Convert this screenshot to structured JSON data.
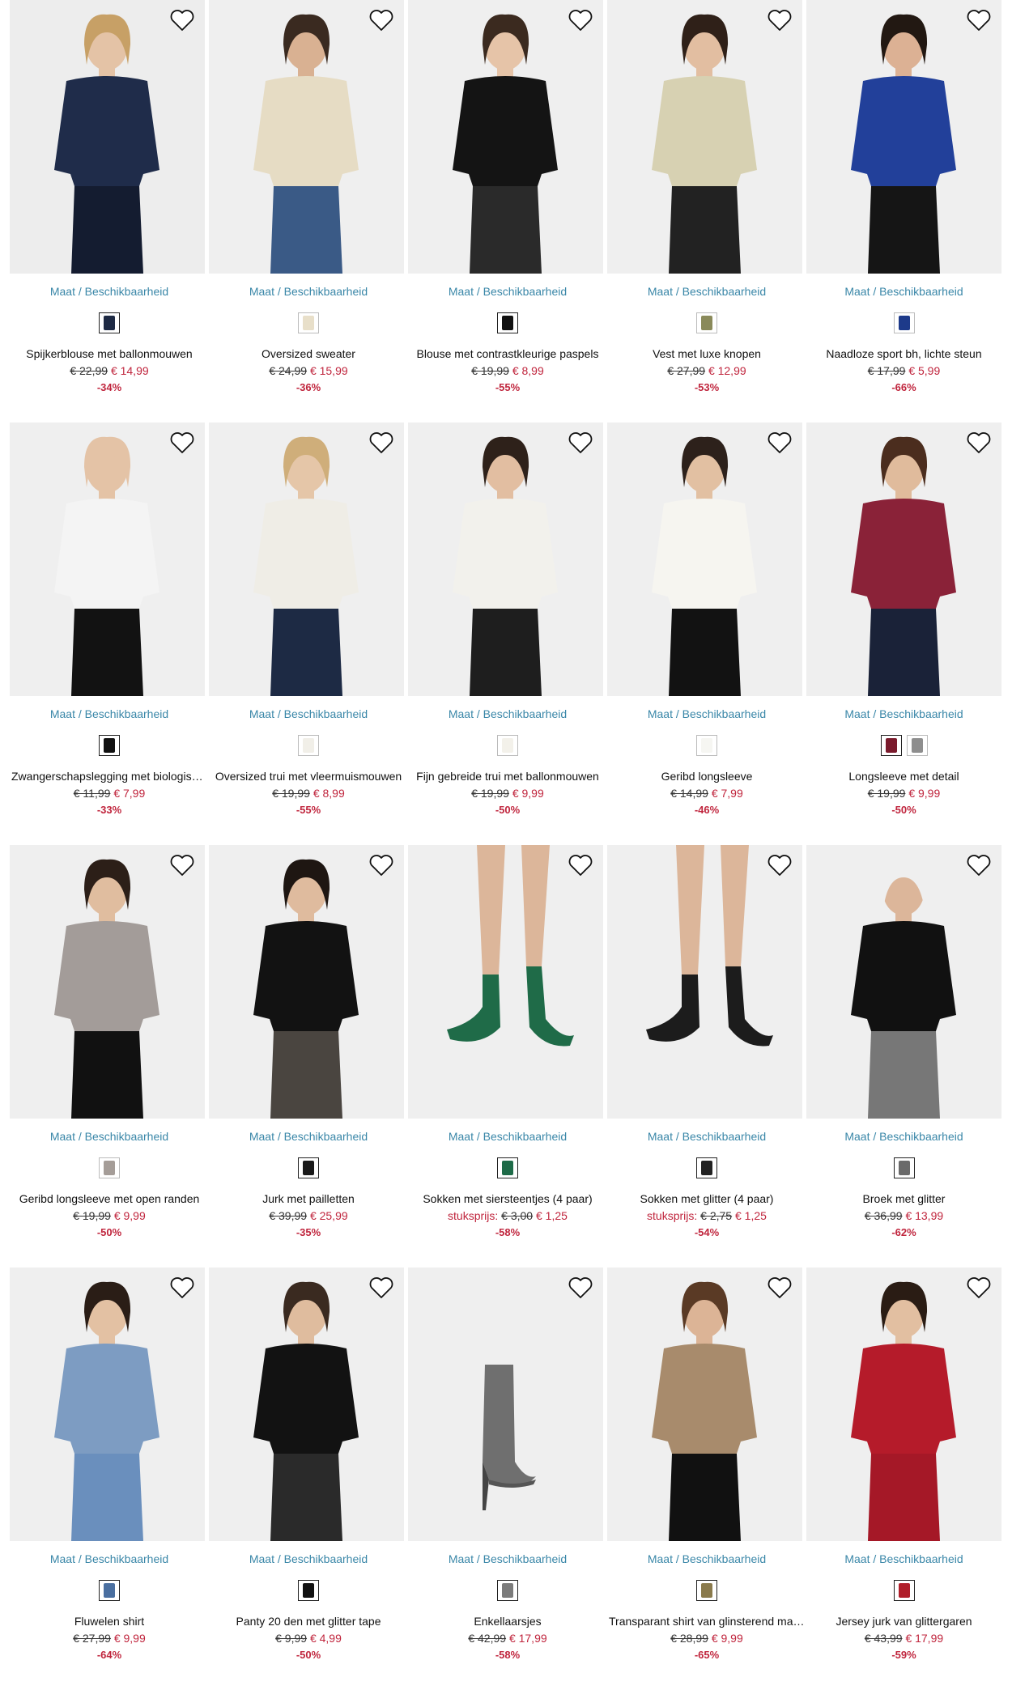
{
  "ui": {
    "size_label": "Maat / Beschikbaarheid",
    "colors": {
      "link": "#3a87a8",
      "sale": "#c0253d"
    }
  },
  "rows": [
    [
      {
        "name": "Spijkerblouse met ballonmouwen",
        "old": "€ 22,99",
        "new": "€ 14,99",
        "discount": "-34%",
        "prefix": "",
        "swatches": [
          {
            "color": "#1e2a44",
            "selected": true
          }
        ],
        "photo": {
          "bg": "#ededed",
          "top": "#1f2c4a",
          "bottom": "#141c30",
          "skin": "#e4c3a6",
          "hair": "#c7a066"
        }
      },
      {
        "name": "Oversized sweater",
        "old": "€ 24,99",
        "new": "€ 15,99",
        "discount": "-36%",
        "prefix": "",
        "swatches": [
          {
            "color": "#e8dfc9",
            "selected": false
          }
        ],
        "photo": {
          "bg": "#efefef",
          "top": "#e6dcc4",
          "bottom": "#3a5a86",
          "skin": "#d9b192",
          "hair": "#3a2a20"
        }
      },
      {
        "name": "Blouse met contrastkleurige paspels",
        "old": "€ 19,99",
        "new": "€ 8,99",
        "discount": "-55%",
        "prefix": "",
        "swatches": [
          {
            "color": "#111111",
            "selected": true
          }
        ],
        "photo": {
          "bg": "#efefef",
          "top": "#141414",
          "bottom": "#2a2a2a",
          "skin": "#e6c4a8",
          "hair": "#3b2a1f"
        }
      },
      {
        "name": "Vest met luxe knopen",
        "old": "€ 27,99",
        "new": "€ 12,99",
        "discount": "-53%",
        "prefix": "",
        "swatches": [
          {
            "color": "#8a8a5a",
            "selected": false
          }
        ],
        "photo": {
          "bg": "#efefef",
          "top": "#d7d1b2",
          "bottom": "#222222",
          "skin": "#e2bea1",
          "hair": "#2f2018"
        }
      },
      {
        "name": "Naadloze sport bh, lichte steun",
        "old": "€ 17,99",
        "new": "€ 5,99",
        "discount": "-66%",
        "prefix": "",
        "swatches": [
          {
            "color": "#1d3a8a",
            "selected": false
          }
        ],
        "photo": {
          "bg": "#efefef",
          "top": "#22409a",
          "bottom": "#151515",
          "skin": "#dcb194",
          "hair": "#221812"
        }
      }
    ],
    [
      {
        "name": "Zwangerschapslegging met biologisch katoen",
        "old": "€ 11,99",
        "new": "€ 7,99",
        "discount": "-33%",
        "prefix": "",
        "swatches": [
          {
            "color": "#111111",
            "selected": true
          }
        ],
        "photo": {
          "bg": "#efefef",
          "top": "#f4f4f4",
          "bottom": "#121212",
          "skin": "#e4c3a6",
          "hair": "#e4c3a6"
        }
      },
      {
        "name": "Oversized trui met vleermuismouwen",
        "old": "€ 19,99",
        "new": "€ 8,99",
        "discount": "-55%",
        "prefix": "",
        "swatches": [
          {
            "color": "#f1efe8",
            "selected": false
          }
        ],
        "photo": {
          "bg": "#efefef",
          "top": "#efede6",
          "bottom": "#1d2a44",
          "skin": "#e5c6a8",
          "hair": "#cfae7a"
        }
      },
      {
        "name": "Fijn gebreide trui met ballonmouwen",
        "old": "€ 19,99",
        "new": "€ 9,99",
        "discount": "-50%",
        "prefix": "",
        "swatches": [
          {
            "color": "#f3f1ea",
            "selected": false
          }
        ],
        "photo": {
          "bg": "#efefef",
          "top": "#f2f1ec",
          "bottom": "#1e1e1e",
          "skin": "#e2bea1",
          "hair": "#2e211a"
        }
      },
      {
        "name": "Geribd longsleeve",
        "old": "€ 14,99",
        "new": "€ 7,99",
        "discount": "-46%",
        "prefix": "",
        "swatches": [
          {
            "color": "#f6f6f2",
            "selected": false
          }
        ],
        "photo": {
          "bg": "#efefef",
          "top": "#f6f5f0",
          "bottom": "#121212",
          "skin": "#e2c0a2",
          "hair": "#2d211b"
        }
      },
      {
        "name": "Longsleeve met detail",
        "old": "€ 19,99",
        "new": "€ 9,99",
        "discount": "-50%",
        "prefix": "",
        "swatches": [
          {
            "color": "#7a1a2c",
            "selected": true
          },
          {
            "color": "#8e8e8e",
            "selected": false
          }
        ],
        "photo": {
          "bg": "#efefef",
          "top": "#8a2238",
          "bottom": "#1a2238",
          "skin": "#e0bb9c",
          "hair": "#4b2d1e"
        }
      }
    ],
    [
      {
        "name": "Geribd longsleeve met open randen",
        "old": "€ 19,99",
        "new": "€ 9,99",
        "discount": "-50%",
        "prefix": "",
        "swatches": [
          {
            "color": "#a59d98",
            "selected": false
          }
        ],
        "photo": {
          "bg": "#efefef",
          "top": "#a39c99",
          "bottom": "#111111",
          "skin": "#e0bd9f",
          "hair": "#2c1f18"
        }
      },
      {
        "name": "Jurk met pailletten",
        "old": "€ 39,99",
        "new": "€ 25,99",
        "discount": "-35%",
        "prefix": "",
        "swatches": [
          {
            "color": "#1a1a1a",
            "selected": true
          }
        ],
        "photo": {
          "bg": "#efefef",
          "top": "#121212",
          "bottom": "#4a4540",
          "skin": "#dfbb9e",
          "hair": "#1e1612"
        }
      },
      {
        "name": "Sokken met siersteentjes (4 paar)",
        "old": "€ 3,00",
        "new": "€ 1,25",
        "discount": "-58%",
        "prefix": "stuksprijs:",
        "swatches": [
          {
            "color": "#1e6b48",
            "selected": true
          }
        ],
        "photo": {
          "bg": "#efefef",
          "top": "#f0f0f0",
          "bottom": "#1f6b48",
          "skin": "#dcb69a",
          "hair": "#efefef"
        }
      },
      {
        "name": "Sokken met glitter (4 paar)",
        "old": "€ 2,75",
        "new": "€ 1,25",
        "discount": "-54%",
        "prefix": "stuksprijs:",
        "swatches": [
          {
            "color": "#222222",
            "selected": true
          }
        ],
        "photo": {
          "bg": "#efefef",
          "top": "#f0f0f0",
          "bottom": "#1c1c1c",
          "skin": "#dcb69a",
          "hair": "#efefef"
        }
      },
      {
        "name": "Broek met glitter",
        "old": "€ 36,99",
        "new": "€ 13,99",
        "discount": "-62%",
        "prefix": "",
        "swatches": [
          {
            "color": "#6a6a6a",
            "selected": true
          }
        ],
        "photo": {
          "bg": "#efefef",
          "top": "#111111",
          "bottom": "#777777",
          "skin": "#dcb69a",
          "hair": "#efefef"
        }
      }
    ],
    [
      {
        "name": "Fluwelen shirt",
        "old": "€ 27,99",
        "new": "€ 9,99",
        "discount": "-64%",
        "prefix": "",
        "swatches": [
          {
            "color": "#4a6fa0",
            "selected": true
          }
        ],
        "photo": {
          "bg": "#efefef",
          "top": "#7d9cc2",
          "bottom": "#6a8fbd",
          "skin": "#e3c1a3",
          "hair": "#2a1d16"
        }
      },
      {
        "name": "Panty 20 den met glitter tape",
        "old": "€ 9,99",
        "new": "€ 4,99",
        "discount": "-50%",
        "prefix": "",
        "swatches": [
          {
            "color": "#111111",
            "selected": true
          }
        ],
        "photo": {
          "bg": "#efefef",
          "top": "#121212",
          "bottom": "#2a2a2a",
          "skin": "#dfbc9e",
          "hair": "#3a2a20"
        }
      },
      {
        "name": "Enkellaarsjes",
        "old": "€ 42,99",
        "new": "€ 17,99",
        "discount": "-58%",
        "prefix": "",
        "swatches": [
          {
            "color": "#7b7b7b",
            "selected": true
          }
        ],
        "photo": {
          "bg": "#efefef",
          "top": "#efefef",
          "bottom": "#6f6f6f",
          "skin": "#efefef",
          "hair": "#efefef"
        }
      },
      {
        "name": "Transparant shirt van glinsterend materiaal",
        "old": "€ 28,99",
        "new": "€ 9,99",
        "discount": "-65%",
        "prefix": "",
        "swatches": [
          {
            "color": "#8a7a4c",
            "selected": true
          }
        ],
        "photo": {
          "bg": "#efefef",
          "top": "#a88b6c",
          "bottom": "#111111",
          "skin": "#dcb496",
          "hair": "#5a3a25"
        }
      },
      {
        "name": "Jersey jurk van glittergaren",
        "old": "€ 43,99",
        "new": "€ 17,99",
        "discount": "-59%",
        "prefix": "",
        "swatches": [
          {
            "color": "#b01e2a",
            "selected": true
          }
        ],
        "photo": {
          "bg": "#efefef",
          "top": "#b51b2a",
          "bottom": "#a51827",
          "skin": "#e2bfa1",
          "hair": "#2a1c14"
        }
      }
    ]
  ]
}
